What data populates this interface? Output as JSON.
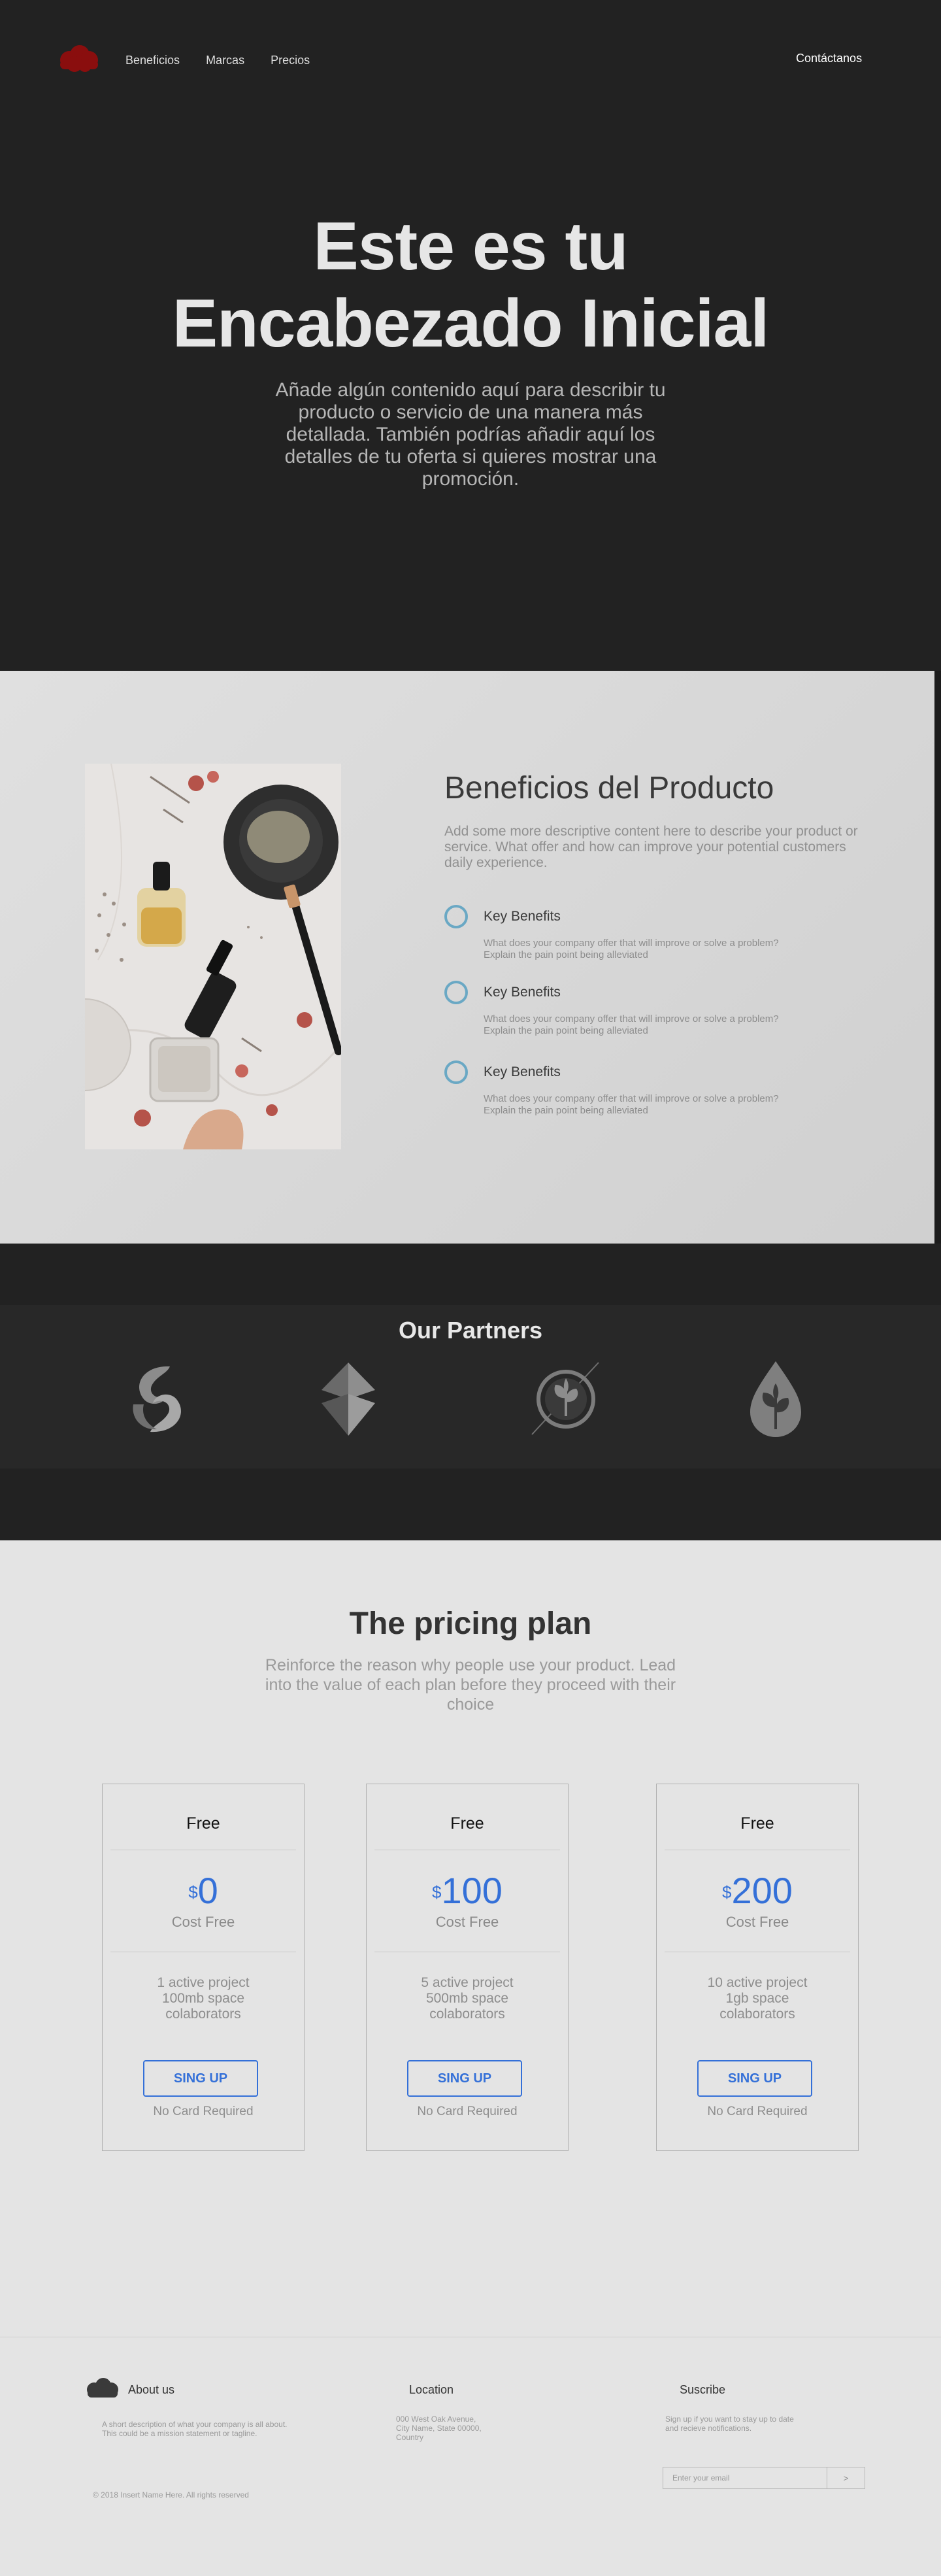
{
  "nav": {
    "links": [
      "Beneficios",
      "Marcas",
      "Precios"
    ],
    "contact": "Contáctanos"
  },
  "hero": {
    "title_line1": "Este es tu",
    "title_line2": "Encabezado Inicial",
    "subtitle": "Añade algún contenido aquí para describir tu producto o servicio de una manera más detallada. También podrías añadir aquí los detalles de tu oferta si quieres mostrar una promoción."
  },
  "benefits": {
    "title": "Beneficios del Producto",
    "description": "Add some more descriptive content here to describe your product or service. What offer and how can improve your potential customers daily experience.",
    "items": [
      {
        "title": "Key Benefits",
        "text": "What does your company offer that will improve or solve a problem? Explain the pain point being alleviated"
      },
      {
        "title": "Key Benefits",
        "text": "What does your company offer that will improve or solve a problem? Explain the pain point being alleviated"
      },
      {
        "title": "Key Benefits",
        "text": "What does your company offer that will improve or solve a problem? Explain the pain point being alleviated"
      }
    ]
  },
  "partners": {
    "title": "Our Partners",
    "logos": [
      "swirl-logo-icon",
      "diamond-logo-icon",
      "leaf-circle-logo-icon",
      "drop-leaf-logo-icon"
    ]
  },
  "pricing": {
    "title": "The pricing plan",
    "subtitle": "Reinforce the reason why people use your product. Lead into the value of each plan before they proceed with their choice",
    "plans": [
      {
        "name": "Free",
        "currency": "$",
        "amount": "0",
        "period": "Cost Free",
        "features": [
          "1 active project",
          "100mb space",
          "colaborators"
        ],
        "button": "SING UP",
        "note": "No Card Required"
      },
      {
        "name": "Free",
        "currency": "$",
        "amount": "100",
        "period": "Cost Free",
        "features": [
          "5 active project",
          "500mb space",
          "colaborators"
        ],
        "button": "SING UP",
        "note": "No Card Required"
      },
      {
        "name": "Free",
        "currency": "$",
        "amount": "200",
        "period": "Cost Free",
        "features": [
          "10 active project",
          "1gb space",
          "colaborators"
        ],
        "button": "SING UP",
        "note": "No Card Required"
      }
    ]
  },
  "footer": {
    "about_title": "About us",
    "about_text_1": "A short description of what your company is all about.",
    "about_text_2": "This could be a mission statement or tagline.",
    "location_title": "Location",
    "location_line1": "000 West Oak Avenue,",
    "location_line2": "City Name, State 00000,",
    "location_line3": "Country",
    "subscribe_title": "Suscribe",
    "subscribe_text_1": "Sign up if you want to stay up to date",
    "subscribe_text_2": "and recieve notifications.",
    "email_placeholder": "Enter your email",
    "submit_label": ">",
    "copyright": "© 2018 Insert Name Here. All rights reserved"
  },
  "colors": {
    "dark_bg": "#222222",
    "accent_blue": "#3470d8",
    "benefit_ring": "#6aa8c4",
    "logo_red": "#8a0e0e"
  }
}
